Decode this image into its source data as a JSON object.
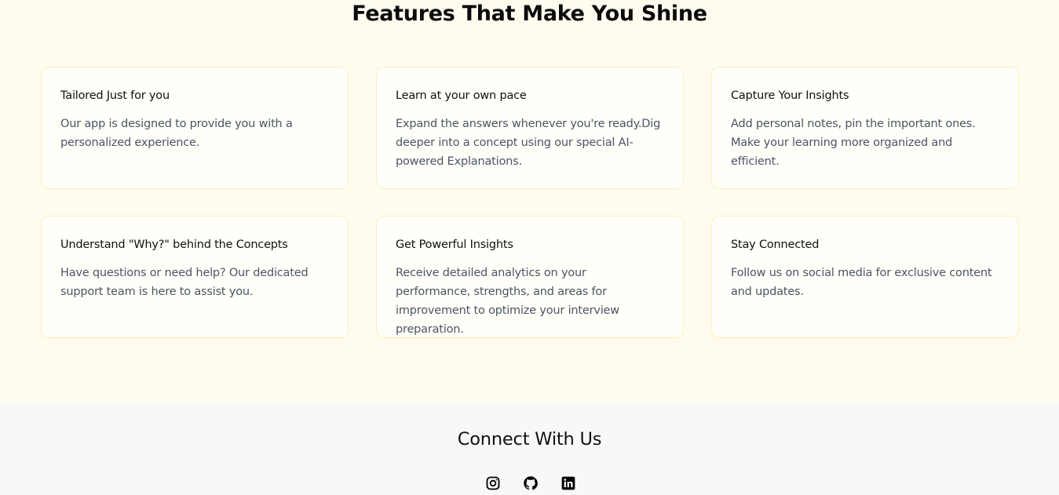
{
  "features": {
    "title": "Features That Make You Shine",
    "cards": [
      {
        "title": "Tailored Just for you",
        "text": "Our app is designed to provide you with a personalized experience."
      },
      {
        "title": "Learn at your own pace",
        "text": "Expand the answers whenever you're ready.Dig deeper into a concept using our special AI-powered Explanations."
      },
      {
        "title": "Capture Your Insights",
        "text": "Add personal notes, pin the important ones. Make your learning more organized and efficient."
      },
      {
        "title": "Understand \"Why?\" behind the Concepts",
        "text": "Have questions or need help? Our dedicated support team is here to assist you."
      },
      {
        "title": "Get Powerful Insights",
        "text": "Receive detailed analytics on your performance, strengths, and areas for improvement to optimize your interview preparation."
      },
      {
        "title": "Stay Connected",
        "text": "Follow us on social media for exclusive content and updates."
      }
    ]
  },
  "footer": {
    "title": "Connect With Us",
    "socials": [
      {
        "icon": "instagram-icon"
      },
      {
        "icon": "github-icon"
      },
      {
        "icon": "linkedin-icon"
      }
    ]
  },
  "colors": {
    "features_bg": "#fffbef",
    "card_bg": "#fffef8",
    "card_border": "#fcefbe",
    "footer_bg": "#f8f8f8",
    "body_text": "#4b5563"
  }
}
